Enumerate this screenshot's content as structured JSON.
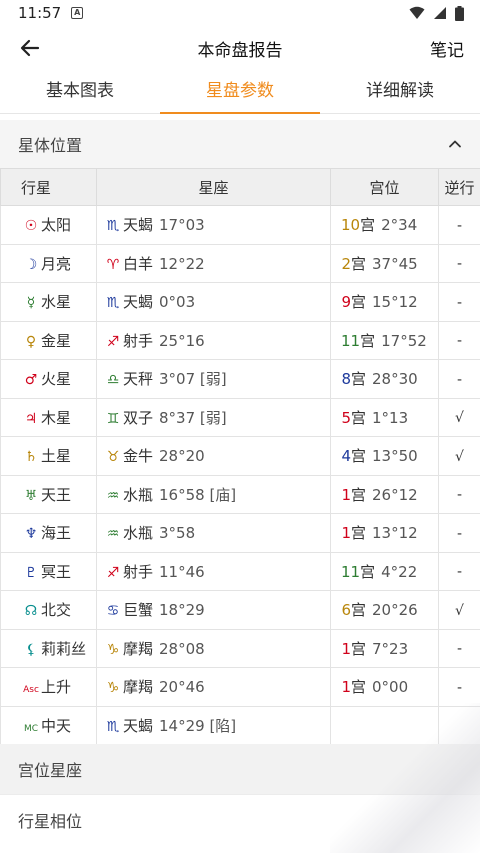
{
  "status": {
    "time": "11:57",
    "notif": "A"
  },
  "header": {
    "title": "本命盘报告",
    "notes": "笔记"
  },
  "tabs": [
    {
      "label": "基本图表",
      "active": false
    },
    {
      "label": "星盘参数",
      "active": true
    },
    {
      "label": "详细解读",
      "active": false
    }
  ],
  "section": {
    "title": "星体位置"
  },
  "table": {
    "headers": [
      "行星",
      "星座",
      "宫位",
      "逆行"
    ],
    "rows": [
      {
        "pglyph": "☉",
        "pcolor": "#d0021b",
        "planet": "太阳",
        "sglyph": "♏",
        "scolor": "#1e3a9c",
        "sign": "天蝎",
        "sdeg": "17°03",
        "hnum": "10",
        "hcolor": "#b8860b",
        "hdeg": "2°34",
        "retro": "-"
      },
      {
        "pglyph": "☽",
        "pcolor": "#1e3a9c",
        "planet": "月亮",
        "sglyph": "♈",
        "scolor": "#d0021b",
        "sign": "白羊",
        "sdeg": "12°22",
        "hnum": "2",
        "hcolor": "#b8860b",
        "hdeg": "37°45",
        "retro": "-"
      },
      {
        "pglyph": "☿",
        "pcolor": "#2e7d32",
        "planet": "水星",
        "sglyph": "♏",
        "scolor": "#1e3a9c",
        "sign": "天蝎",
        "sdeg": "0°03",
        "hnum": "9",
        "hcolor": "#d0021b",
        "hdeg": "15°12",
        "retro": "-"
      },
      {
        "pglyph": "♀",
        "pcolor": "#b8860b",
        "planet": "金星",
        "sglyph": "♐",
        "scolor": "#d0021b",
        "sign": "射手",
        "sdeg": "25°16",
        "hnum": "11",
        "hcolor": "#2e7d32",
        "hdeg": "17°52",
        "retro": "-"
      },
      {
        "pglyph": "♂",
        "pcolor": "#d0021b",
        "planet": "火星",
        "sglyph": "♎",
        "scolor": "#2e7d32",
        "sign": "天秤",
        "sdeg": "3°07 [弱]",
        "hnum": "8",
        "hcolor": "#1e3a9c",
        "hdeg": "28°30",
        "retro": "-"
      },
      {
        "pglyph": "♃",
        "pcolor": "#d0021b",
        "planet": "木星",
        "sglyph": "♊",
        "scolor": "#2e7d32",
        "sign": "双子",
        "sdeg": "8°37 [弱]",
        "hnum": "5",
        "hcolor": "#d0021b",
        "hdeg": "1°13",
        "retro": "√"
      },
      {
        "pglyph": "♄",
        "pcolor": "#b8860b",
        "planet": "土星",
        "sglyph": "♉",
        "scolor": "#b8860b",
        "sign": "金牛",
        "sdeg": "28°20",
        "hnum": "4",
        "hcolor": "#1e3a9c",
        "hdeg": "13°50",
        "retro": "√"
      },
      {
        "pglyph": "♅",
        "pcolor": "#2e7d32",
        "planet": "天王",
        "sglyph": "♒",
        "scolor": "#2e7d32",
        "sign": "水瓶",
        "sdeg": "16°58 [庙]",
        "hnum": "1",
        "hcolor": "#d0021b",
        "hdeg": "26°12",
        "retro": "-"
      },
      {
        "pglyph": "♆",
        "pcolor": "#1e3a9c",
        "planet": "海王",
        "sglyph": "♒",
        "scolor": "#2e7d32",
        "sign": "水瓶",
        "sdeg": "3°58",
        "hnum": "1",
        "hcolor": "#d0021b",
        "hdeg": "13°12",
        "retro": "-"
      },
      {
        "pglyph": "♇",
        "pcolor": "#1e3a9c",
        "planet": "冥王",
        "sglyph": "♐",
        "scolor": "#d0021b",
        "sign": "射手",
        "sdeg": "11°46",
        "hnum": "11",
        "hcolor": "#2e7d32",
        "hdeg": "4°22",
        "retro": "-"
      },
      {
        "pglyph": "☊",
        "pcolor": "#0a8f8f",
        "planet": "北交",
        "sglyph": "♋",
        "scolor": "#1e3a9c",
        "sign": "巨蟹",
        "sdeg": "18°29",
        "hnum": "6",
        "hcolor": "#b8860b",
        "hdeg": "20°26",
        "retro": "√"
      },
      {
        "pglyph": "⚸",
        "pcolor": "#0a8f8f",
        "planet": "莉莉丝",
        "sglyph": "♑",
        "scolor": "#b8860b",
        "sign": "摩羯",
        "sdeg": "28°08",
        "hnum": "1",
        "hcolor": "#d0021b",
        "hdeg": "7°23",
        "retro": "-"
      },
      {
        "pglyph": "Asc",
        "pcolor": "#d0021b",
        "planet": "上升",
        "sglyph": "♑",
        "scolor": "#b8860b",
        "sign": "摩羯",
        "sdeg": "20°46",
        "hnum": "1",
        "hcolor": "#d0021b",
        "hdeg": "0°00",
        "retro": "-"
      },
      {
        "pglyph": "MC",
        "pcolor": "#2e7d32",
        "planet": "中天",
        "sglyph": "♏",
        "scolor": "#1e3a9c",
        "sign": "天蝎",
        "sdeg": "14°29 [陷]",
        "hnum": "",
        "hcolor": "#333333",
        "hdeg": "",
        "retro": ""
      }
    ]
  },
  "sections_below": [
    {
      "title": "宫位星座"
    },
    {
      "title": "行星相位"
    }
  ],
  "house_suffix": "宫",
  "colors": {
    "accent": "#f08c1e"
  }
}
